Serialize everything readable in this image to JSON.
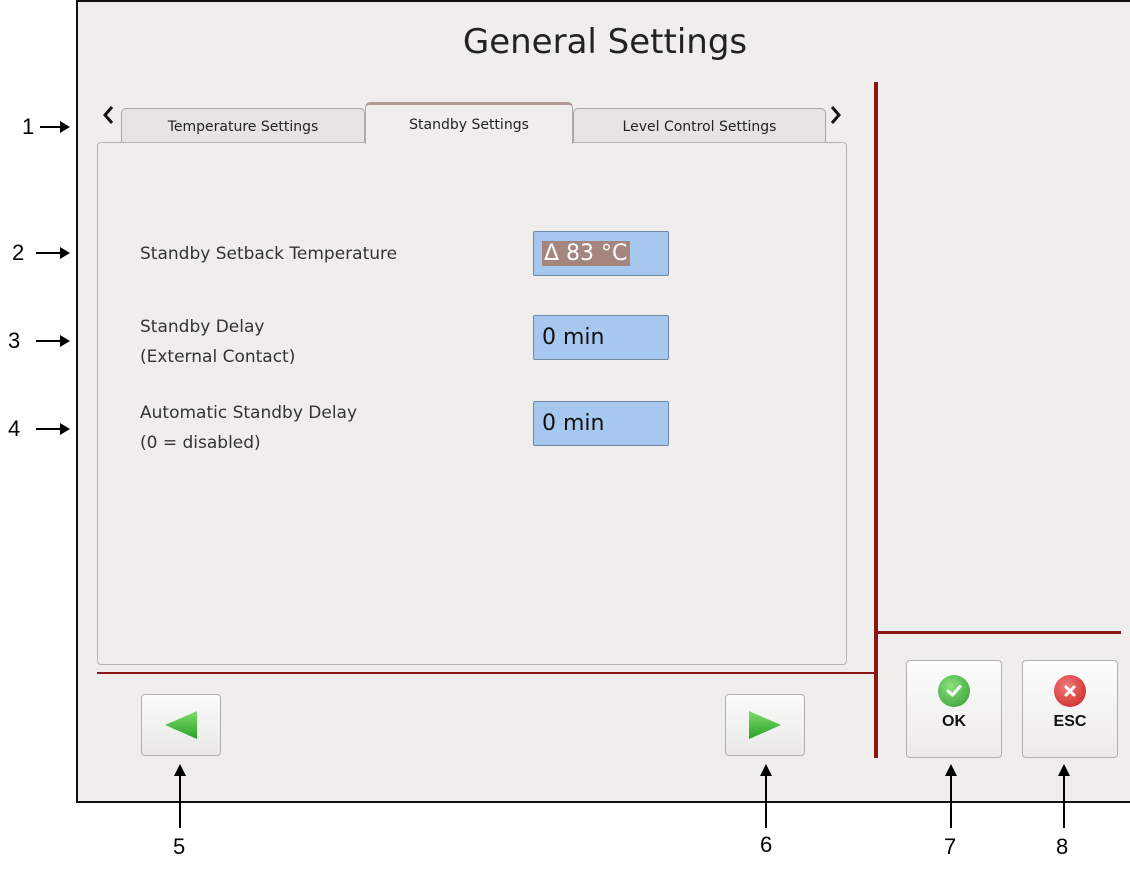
{
  "screen": {
    "title": "General Settings"
  },
  "tabs": [
    {
      "label": "Temperature Settings",
      "active": false
    },
    {
      "label": "Standby Settings",
      "active": true
    },
    {
      "label": "Level Control Settings",
      "active": false
    }
  ],
  "tab_nav": {
    "prev_icon": "chevron-left-icon",
    "next_icon": "chevron-right-icon"
  },
  "settings": [
    {
      "label_line1": "Standby Setback Temperature",
      "label_line2": "",
      "value": "Δ 83 °C",
      "selected": true
    },
    {
      "label_line1": "Standby Delay",
      "label_line2": "(External Contact)",
      "value": "0 min",
      "selected": false
    },
    {
      "label_line1": "Automatic Standby Delay",
      "label_line2": "(0 = disabled)",
      "value": "0 min",
      "selected": false
    }
  ],
  "buttons": {
    "prev_icon": "arrow-left-icon",
    "next_icon": "arrow-right-icon",
    "ok_label": "OK",
    "esc_label": "ESC"
  },
  "callouts": [
    "1",
    "2",
    "3",
    "4",
    "5",
    "6",
    "7",
    "8"
  ],
  "colors": {
    "accent_line": "#8a1616",
    "field_bg": "#a7c8ee",
    "selection_bg": "#a4867e",
    "ok_green": "#3fae3f",
    "esc_red": "#d83232"
  }
}
